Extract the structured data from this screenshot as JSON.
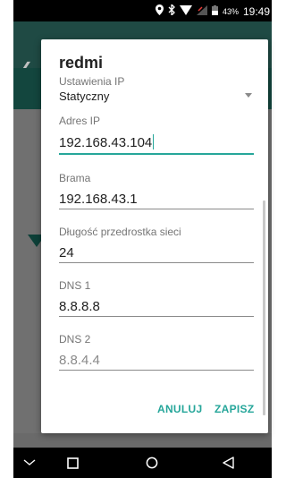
{
  "status_bar": {
    "battery_percent": "43%",
    "time": "19:49"
  },
  "dialog": {
    "title": "redmi",
    "ip_settings_label": "Ustawienia IP",
    "ip_settings_value": "Statyczny",
    "fields": [
      {
        "label": "Adres IP",
        "value": "192.168.43.104",
        "hint": false,
        "active": true
      },
      {
        "label": "Brama",
        "value": "192.168.43.1",
        "hint": false,
        "active": false
      },
      {
        "label": "Długość przedrostka sieci",
        "value": "24",
        "hint": false,
        "active": false
      },
      {
        "label": "DNS 1",
        "value": "8.8.8.8",
        "hint": false,
        "active": false
      },
      {
        "label": "DNS 2",
        "value": "8.8.4.4",
        "hint": true,
        "active": false
      }
    ],
    "cancel_label": "ANULUJ",
    "save_label": "ZAPISZ"
  },
  "colors": {
    "accent": "#26a69a",
    "status_bar": "#000000",
    "background_dim_appbar": "#1f4a44"
  }
}
